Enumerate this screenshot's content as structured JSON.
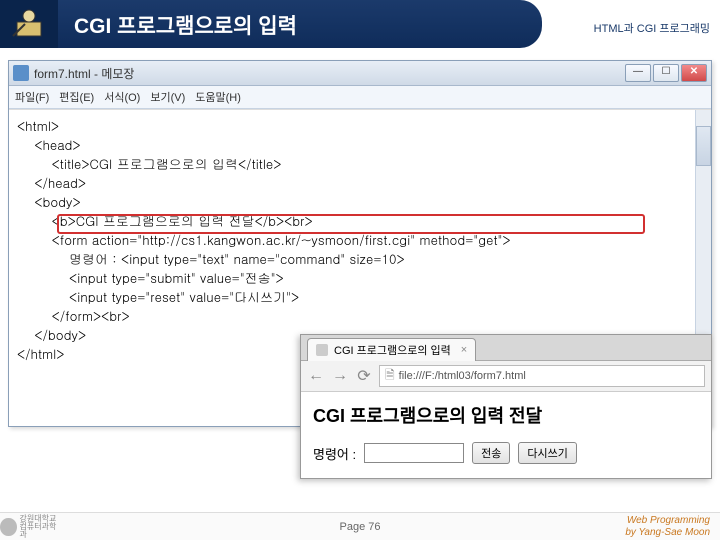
{
  "header": {
    "title": "CGI 프로그램으로의 입력",
    "subtitle": "HTML과 CGI 프로그래밍"
  },
  "notepad": {
    "title": "form7.html - 메모장",
    "menu": {
      "file": "파일(F)",
      "edit": "편집(E)",
      "format": "서식(O)",
      "view": "보기(V)",
      "help": "도움말(H)"
    },
    "code_line_01": "<html>",
    "code_line_02": "    <head>",
    "code_line_03": "        <title>CGI 프로그램으로의 입력</title>",
    "code_line_04": "    </head>",
    "code_line_05": "    <body>",
    "code_line_06": "        <b>CGI 프로그램으로의 입력 전달</b><br>",
    "code_line_07": "        <form action=\"http://cs1.kangwon.ac.kr/~ysmoon/first.cgi\" method=\"get\">",
    "code_line_08": "            명령어 : <input type=\"text\" name=\"command\" size=10>",
    "code_line_09": "            <input type=\"submit\" value=\"전송\">",
    "code_line_10": "            <input type=\"reset\" value=\"다시쓰기\">",
    "code_line_11": "        </form><br>",
    "code_line_12": "    </body>",
    "code_line_13": "</html>"
  },
  "browser": {
    "tab_title": "CGI 프로그램으로의 입력",
    "url": "file:///F:/html03/form7.html",
    "content_title": "CGI 프로그램으로의 입력 전달",
    "form_label": "명령어 :",
    "submit_label": "전송",
    "reset_label": "다시쓰기"
  },
  "footer": {
    "logo_line1": "강원대학교",
    "logo_line2": "컴퓨터과학과",
    "page": "Page 76",
    "credit_line1": "Web Programming",
    "credit_line2": "by Yang-Sae Moon"
  }
}
